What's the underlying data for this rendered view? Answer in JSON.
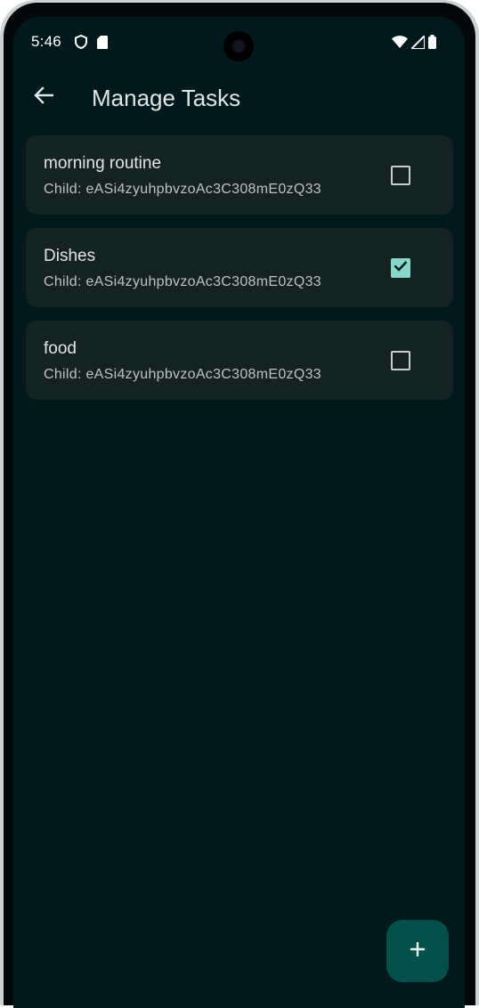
{
  "status_bar": {
    "time": "5:46",
    "left_icons": [
      "shield-icon",
      "sd-card-icon"
    ],
    "right_icons": [
      "wifi-icon",
      "cell-signal-icon",
      "battery-icon"
    ]
  },
  "app_bar": {
    "back_icon": "arrow-left-icon",
    "title": "Manage Tasks"
  },
  "tasks": [
    {
      "title": "morning routine",
      "subtitle": "Child: eASi4zyuhpbvzoAc3C308mE0zQ33",
      "checked": false
    },
    {
      "title": "Dishes",
      "subtitle": "Child: eASi4zyuhpbvzoAc3C308mE0zQ33",
      "checked": true
    },
    {
      "title": "food",
      "subtitle": "Child: eASi4zyuhpbvzoAc3C308mE0zQ33",
      "checked": false
    }
  ],
  "fab": {
    "icon": "plus-icon"
  },
  "colors": {
    "background": "#01191a",
    "card": "#142222",
    "checkbox_checked": "#86d7c9",
    "fab": "#034f49"
  }
}
